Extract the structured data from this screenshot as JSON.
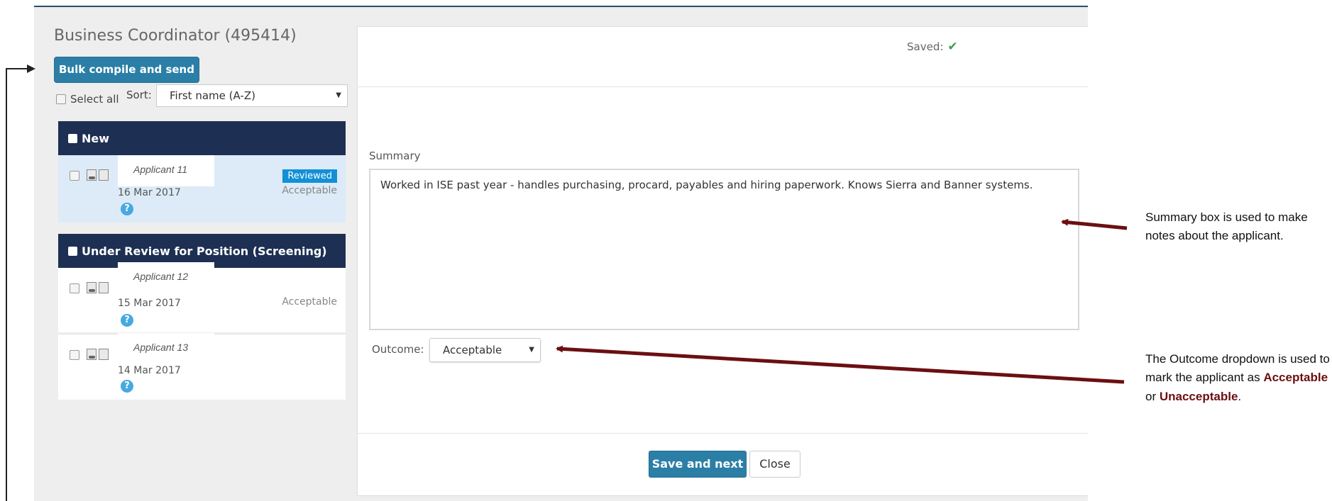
{
  "page": {
    "title": "Business Coordinator (495414)",
    "bulk_button": "Bulk compile and send",
    "select_all": "Select all",
    "sort_label": "Sort:",
    "sort_value": "First name (A-Z)"
  },
  "groups": [
    {
      "name": "New",
      "applicants": [
        {
          "name": "Applicant 11",
          "date": "16 Mar 2017",
          "badge": "Reviewed",
          "status": "Acceptable"
        }
      ]
    },
    {
      "name": "Under Review for Position (Screening)",
      "applicants": [
        {
          "name": "Applicant 12",
          "date": "15 Mar 2017",
          "status": "Acceptable"
        },
        {
          "name": "Applicant 13",
          "date": "14 Mar 2017"
        }
      ]
    }
  ],
  "help_glyph": "?",
  "detail": {
    "saved_label": "Saved:",
    "saved_icon": "check-icon",
    "summary_label": "Summary",
    "summary_text": "Worked in ISE past year - handles purchasing, procard, payables and hiring paperwork.  Knows Sierra and Banner systems.",
    "outcome_label": "Outcome:",
    "outcome_value": "Acceptable",
    "save_next_button": "Save and next",
    "close_button": "Close"
  },
  "annotations": {
    "summary_note": "Summary box is used to make notes about the applicant.",
    "outcome_note_prefix": "The Outcome dropdown is used to mark the applicant as",
    "outcome_note_acceptable": "Acceptable",
    "outcome_note_or": "or",
    "outcome_note_unacceptable": "Unacceptable",
    "outcome_note_end": "."
  },
  "colors": {
    "primary_button": "#2b7fa6",
    "group_header": "#1d2f52",
    "badge": "#1290d6",
    "annotation_arrow": "#6b0f12"
  }
}
